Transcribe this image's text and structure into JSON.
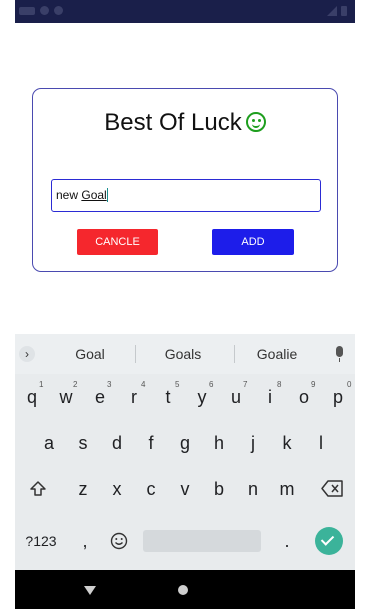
{
  "dialog": {
    "title": "Best Of Luck",
    "input_prefix": "new ",
    "input_word": "Goal",
    "cancel_label": "CANCLE",
    "add_label": "ADD"
  },
  "keyboard": {
    "suggestions": [
      "Goal",
      "Goals",
      "Goalie"
    ],
    "row1": [
      "q",
      "w",
      "e",
      "r",
      "t",
      "y",
      "u",
      "i",
      "o",
      "p"
    ],
    "row1_hints": [
      "1",
      "2",
      "3",
      "4",
      "5",
      "6",
      "7",
      "8",
      "9",
      "0"
    ],
    "row2": [
      "a",
      "s",
      "d",
      "f",
      "g",
      "h",
      "j",
      "k",
      "l"
    ],
    "row3": [
      "z",
      "x",
      "c",
      "v",
      "b",
      "n",
      "m"
    ],
    "symbols_label": "?123",
    "comma_label": ",",
    "period_label": "."
  },
  "colors": {
    "cancel": "#f5272d",
    "add": "#1d1dea",
    "enter": "#3bb39a",
    "smiley": "#1e9e1e"
  },
  "icons": [
    "smiley-icon",
    "chevron-right-icon",
    "mic-icon",
    "shift-icon",
    "backspace-icon",
    "emoji-icon",
    "check-icon",
    "back-icon",
    "home-icon"
  ]
}
